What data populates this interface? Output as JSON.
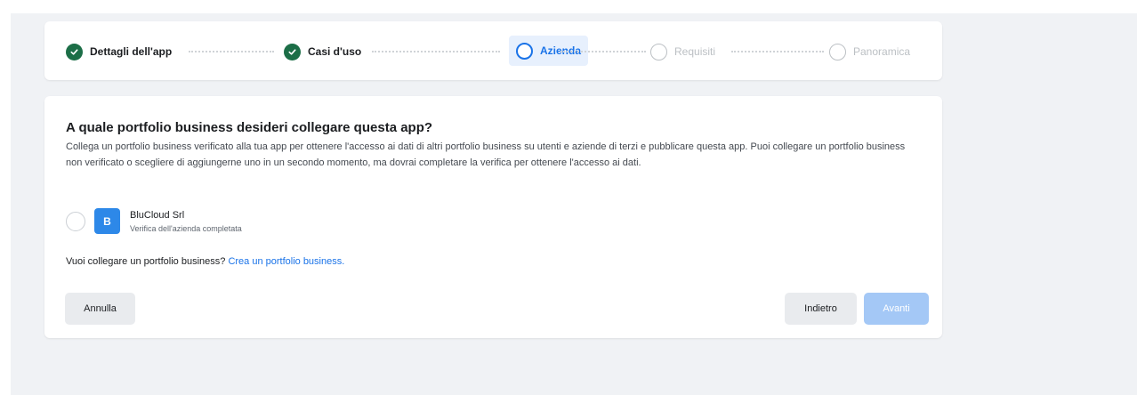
{
  "stepper": {
    "steps": [
      {
        "label": "Dettagli dell'app",
        "state": "done"
      },
      {
        "label": "Casi d'uso",
        "state": "done"
      },
      {
        "label": "Azienda",
        "state": "current"
      },
      {
        "label": "Requisiti",
        "state": "todo"
      },
      {
        "label": "Panoramica",
        "state": "todo"
      }
    ]
  },
  "main": {
    "title": "A quale portfolio business desideri collegare questa app?",
    "description": "Collega un portfolio business verificato alla tua app per ottenere l'accesso ai dati di altri portfolio business su utenti e aziende di terzi e pubblicare questa app. Puoi collegare un portfolio business non verificato o scegliere di aggiungerne uno in un secondo momento, ma dovrai completare la verifica per ottenere l'accesso ai dati.",
    "business": {
      "initial": "B",
      "name": "BluCloud Srl",
      "status": "Verifica dell'azienda completata"
    },
    "link_prompt": "Vuoi collegare un portfolio business?",
    "link_text": "Crea un portfolio business."
  },
  "buttons": {
    "cancel": "Annulla",
    "back": "Indietro",
    "next": "Avanti"
  },
  "colors": {
    "done_check": "#1c6e47",
    "accent": "#1a73e8",
    "disabled_primary": "#a4c8f6"
  }
}
